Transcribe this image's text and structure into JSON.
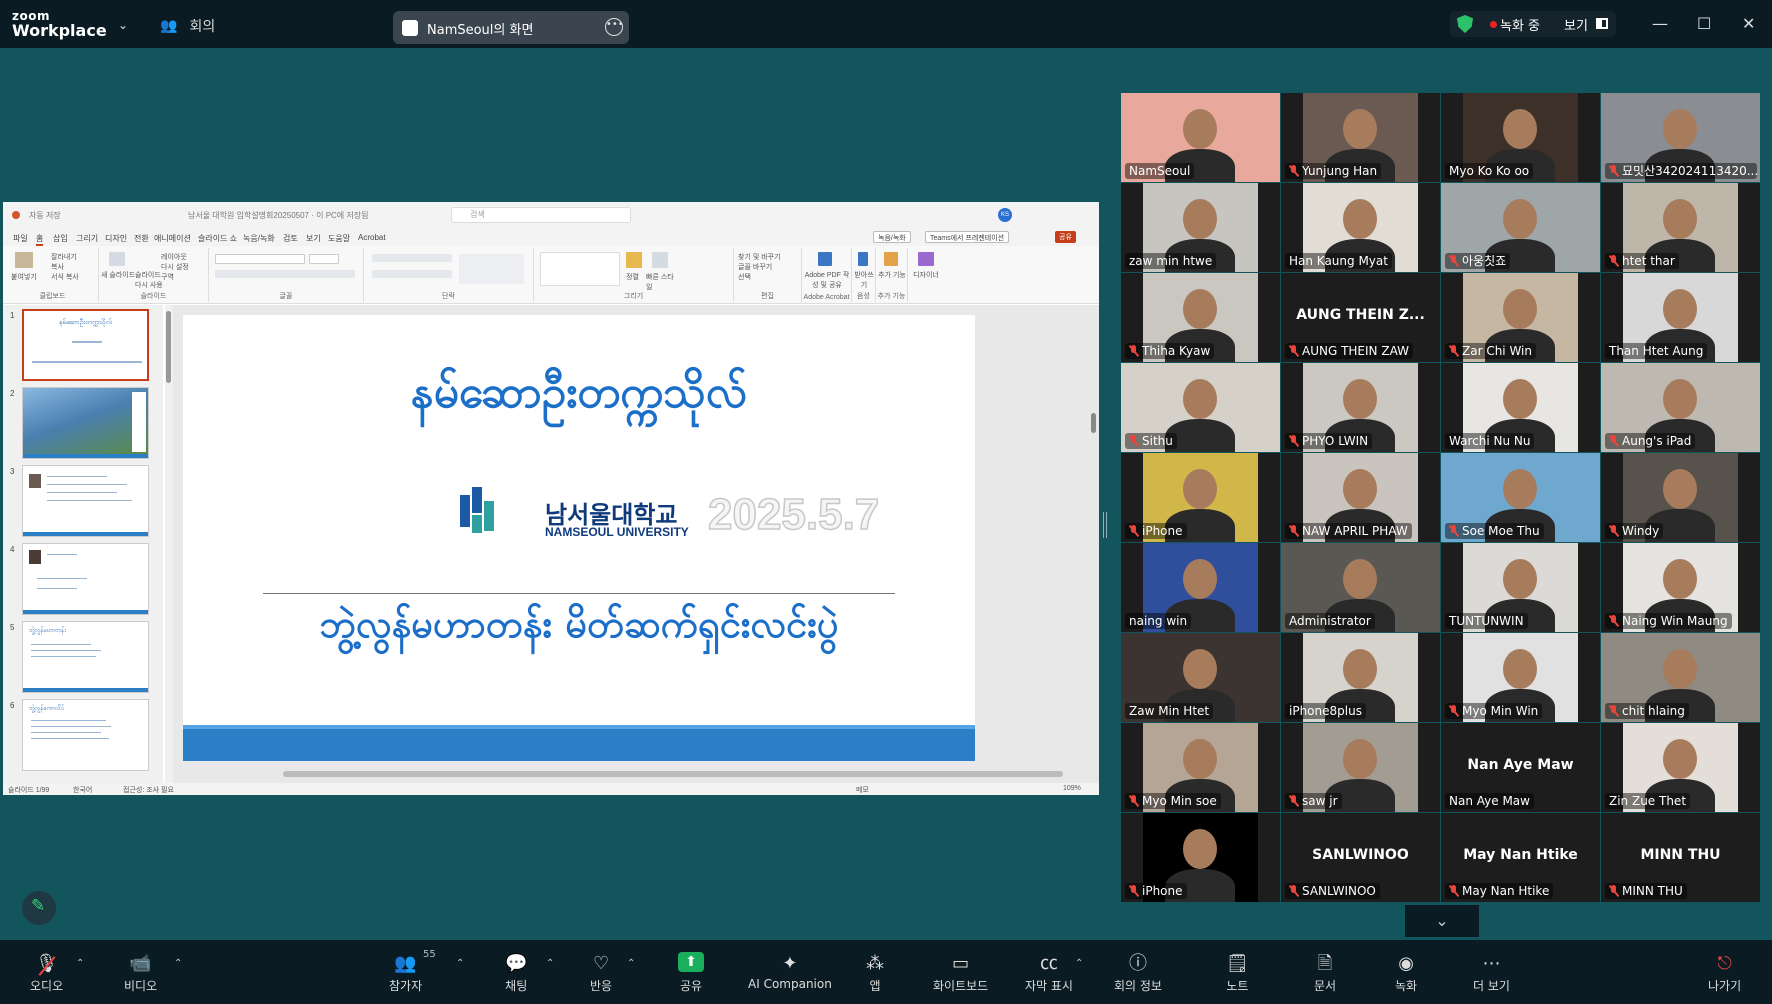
{
  "titlebar": {
    "logo_top": "zoom",
    "logo_bottom": "Workplace",
    "meeting_label": "회의",
    "share_title": "NamSeoul의 화면",
    "recording_label": "녹화 중",
    "view_label": "보기"
  },
  "powerpoint": {
    "title_left": "자동 저장",
    "title_doc": "남서울 대학원 입학설명회20250507 · 이 PC에 저장됨",
    "search_placeholder": "검색",
    "avatar_initials": "KS",
    "menus": [
      "파일",
      "홈",
      "삽입",
      "그리기",
      "디자인",
      "전환",
      "애니메이션",
      "슬라이드 쇼",
      "녹음/녹화",
      "검토",
      "보기",
      "도움말",
      "Acrobat"
    ],
    "menu_record": "녹음/녹화",
    "menu_teams": "Teams에서 프레젠테이션",
    "menu_share": "공유",
    "ribbon_groups": [
      "클립보드",
      "슬라이드",
      "글꼴",
      "단락",
      "그리기",
      "편집",
      "Adobe Acrobat",
      "음성",
      "추가 기능"
    ],
    "ribbon_cmds": {
      "paste": "붙여넣기",
      "cut": "잘라내기",
      "copy": "복사",
      "format": "서식 복사",
      "new_slide": "새 슬라이드",
      "reuse": "슬라이드 다시 사용",
      "layout": "레이아웃",
      "reset": "다시 설정",
      "section": "구역",
      "arrange": "정렬",
      "quick_styles": "빠른 스타일",
      "find": "찾기 및 바꾸기",
      "replace": "글꼴 바꾸기",
      "select": "선택",
      "adobe": "Adobe PDF 작성 및 공유",
      "dictate": "받아쓰기",
      "addins": "추가 기능",
      "designer": "디자이너"
    },
    "slide": {
      "heading": "နမ်ဆောဦးတက္ကသိုလ်",
      "uni_korean": "남서울대학교",
      "uni_english": "NAMSEOUL UNIVERSITY",
      "date": "2025.5.7",
      "subheading": "ဘွဲ့လွန်မဟာတန်း မိတ်ဆက်ရှင်းလင်းပွဲ"
    },
    "thumbnails": [
      {
        "num": "1",
        "text": "နမ်ဆောဦးတက္ကသိုလ်"
      },
      {
        "num": "2",
        "text": ""
      },
      {
        "num": "3",
        "text": ""
      },
      {
        "num": "4",
        "text": ""
      },
      {
        "num": "5",
        "text": "ဘွဲ့လွန်မဟာတန်း"
      },
      {
        "num": "6",
        "text": "ဘွဲ့လွန်ကောလိပ်"
      }
    ],
    "status": {
      "slide_count": "슬라이드 1/99",
      "language": "한국어",
      "accessibility": "접근성: 조사 필요",
      "notes": "메모",
      "zoom": "109%"
    }
  },
  "participants": [
    {
      "name": "NamSeoul",
      "muted": false,
      "video": true,
      "active": true,
      "color": "#e9a89c"
    },
    {
      "name": "Yunjung Han",
      "muted": true,
      "video": true,
      "color": "#6b5a52"
    },
    {
      "name": "Myo Ko Ko oo",
      "muted": false,
      "video": true,
      "color": "#3c3028"
    },
    {
      "name": "묘밋산342024113420...",
      "muted": true,
      "video": true,
      "color": "#8a8e93"
    },
    {
      "name": "zaw min htwe",
      "muted": false,
      "video": true,
      "color": "#c7c5bf"
    },
    {
      "name": "Han Kaung Myat",
      "muted": false,
      "video": true,
      "color": "#e2ddd4"
    },
    {
      "name": "아웅칫죠",
      "muted": true,
      "video": true,
      "color": "#9fa6a8"
    },
    {
      "name": "htet thar",
      "muted": true,
      "video": true,
      "color": "#bfb6aa"
    },
    {
      "name": "Thiha Kyaw",
      "muted": true,
      "video": true,
      "color": "#c9c7c0"
    },
    {
      "name": "AUNG THEIN ZAW",
      "muted": true,
      "video": false,
      "bigname": "AUNG THEIN Z..."
    },
    {
      "name": "Zar Chi Win",
      "muted": true,
      "video": true,
      "color": "#c6b7a3"
    },
    {
      "name": "Than Htet Aung",
      "muted": false,
      "video": true,
      "color": "#d8d8d8"
    },
    {
      "name": "Sithu",
      "muted": true,
      "video": true,
      "color": "#d5d1c8"
    },
    {
      "name": "PHYO LWIN",
      "muted": true,
      "video": true,
      "color": "#cbc8c2"
    },
    {
      "name": "Warchi Nu Nu",
      "muted": false,
      "video": true,
      "color": "#e8e6e2"
    },
    {
      "name": "Aung's iPad",
      "muted": true,
      "video": true,
      "color": "#bdb8b0"
    },
    {
      "name": "iPhone",
      "muted": true,
      "video": true,
      "color": "#d1b64a"
    },
    {
      "name": "NAW APRIL PHAW",
      "muted": true,
      "video": true,
      "color": "#c9c4bd"
    },
    {
      "name": "Soe Moe Thu",
      "muted": true,
      "video": true,
      "color": "#6ea8cf"
    },
    {
      "name": "Windy",
      "muted": true,
      "video": true,
      "color": "#57524c"
    },
    {
      "name": "naing win",
      "muted": false,
      "video": true,
      "color": "#2f4e9b"
    },
    {
      "name": "Administrator",
      "muted": false,
      "video": true,
      "color": "#5a5852"
    },
    {
      "name": "TUNTUNWIN",
      "muted": false,
      "video": true,
      "color": "#dcdad6"
    },
    {
      "name": "Naing Win Maung",
      "muted": true,
      "video": true,
      "color": "#e5e3df"
    },
    {
      "name": "Zaw Min Htet",
      "muted": false,
      "video": true,
      "color": "#3b3430"
    },
    {
      "name": "iPhone8plus",
      "muted": false,
      "video": true,
      "color": "#d6d2cc"
    },
    {
      "name": "Myo Min Win",
      "muted": true,
      "video": true,
      "color": "#e1e1e1"
    },
    {
      "name": "chit hlaing",
      "muted": true,
      "video": true,
      "color": "#8f8a82"
    },
    {
      "name": "Myo Min soe",
      "muted": true,
      "video": true,
      "color": "#b5a595"
    },
    {
      "name": "saw jr",
      "muted": true,
      "video": true,
      "color": "#a29c92"
    },
    {
      "name": "Nan Aye Maw",
      "muted": false,
      "video": false,
      "bigname": "Nan Aye Maw"
    },
    {
      "name": "Zin Zue Thet",
      "muted": false,
      "video": true,
      "color": "#e3ded8"
    },
    {
      "name": "iPhone",
      "muted": true,
      "video": true,
      "color": "#000000"
    },
    {
      "name": "SANLWINOO",
      "muted": true,
      "video": false,
      "bigname": "SANLWINOO"
    },
    {
      "name": "May Nan Htike",
      "muted": true,
      "video": false,
      "bigname": "May Nan Htike"
    },
    {
      "name": "MINN THU",
      "muted": true,
      "video": false,
      "bigname": "MINN THU"
    }
  ],
  "toolbar": {
    "audio": "오디오",
    "video": "비디오",
    "participants": "참가자",
    "participants_count": "55",
    "chat": "채팅",
    "reactions": "반응",
    "share": "공유",
    "ai": "AI Companion",
    "apps": "앱",
    "whiteboard": "화이트보드",
    "captions": "자막 표시",
    "info": "회의 정보",
    "notes": "노트",
    "docs": "문서",
    "record": "녹화",
    "more": "더 보기",
    "leave": "나가기"
  },
  "colors": {
    "background": "#12555c",
    "bar": "#0a1b24",
    "accent_green": "#27d87e",
    "mute_red": "#e8453c",
    "ppt_accent": "#c43e1c",
    "slide_blue": "#1c6fc8"
  }
}
